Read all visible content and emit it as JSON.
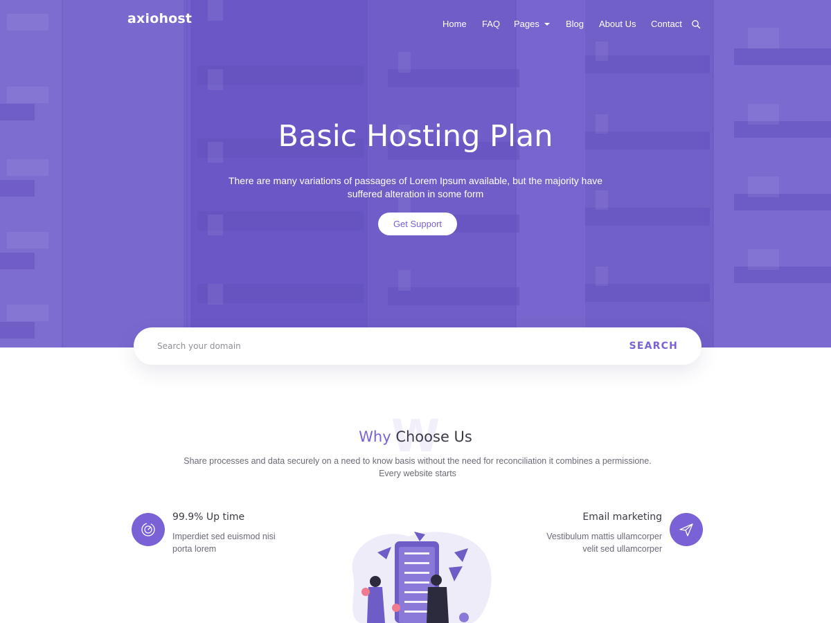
{
  "brand": {
    "logo": "axiohost"
  },
  "nav": {
    "items": [
      {
        "label": "Home"
      },
      {
        "label": "FAQ"
      },
      {
        "label": "Pages"
      },
      {
        "label": "Blog"
      },
      {
        "label": "About Us"
      },
      {
        "label": "Contact"
      }
    ],
    "search_icon": "search-icon"
  },
  "hero": {
    "title": "Basic Hosting Plan",
    "subtitle": "There are many variations of passages of Lorem Ipsum available, but the majority have suffered alteration in some form",
    "button": "Get Support"
  },
  "domain_search": {
    "placeholder": "Search your domain",
    "value": "",
    "button": "SEARCH"
  },
  "why": {
    "watermark": "W",
    "title_accent": "Why",
    "title_rest": " Choose Us",
    "description": "Share processes and data securely on a need to know basis without the need for reconciliation it combines a permissione. Every website starts"
  },
  "features": [
    {
      "title": "99.9% Up time",
      "description": "Imperdiet sed euismod nisi porta lorem",
      "icon": "speedometer-icon"
    },
    {
      "title": "Email marketing",
      "description": "Vestibulum mattis ullamcorper velit sed ullamcorper",
      "icon": "paper-plane-icon"
    }
  ],
  "colors": {
    "accent": "#7b61d6",
    "hero_overlay": "#6c58c9",
    "text_dark": "#3b3b48",
    "text_body": "#6b6b78"
  }
}
